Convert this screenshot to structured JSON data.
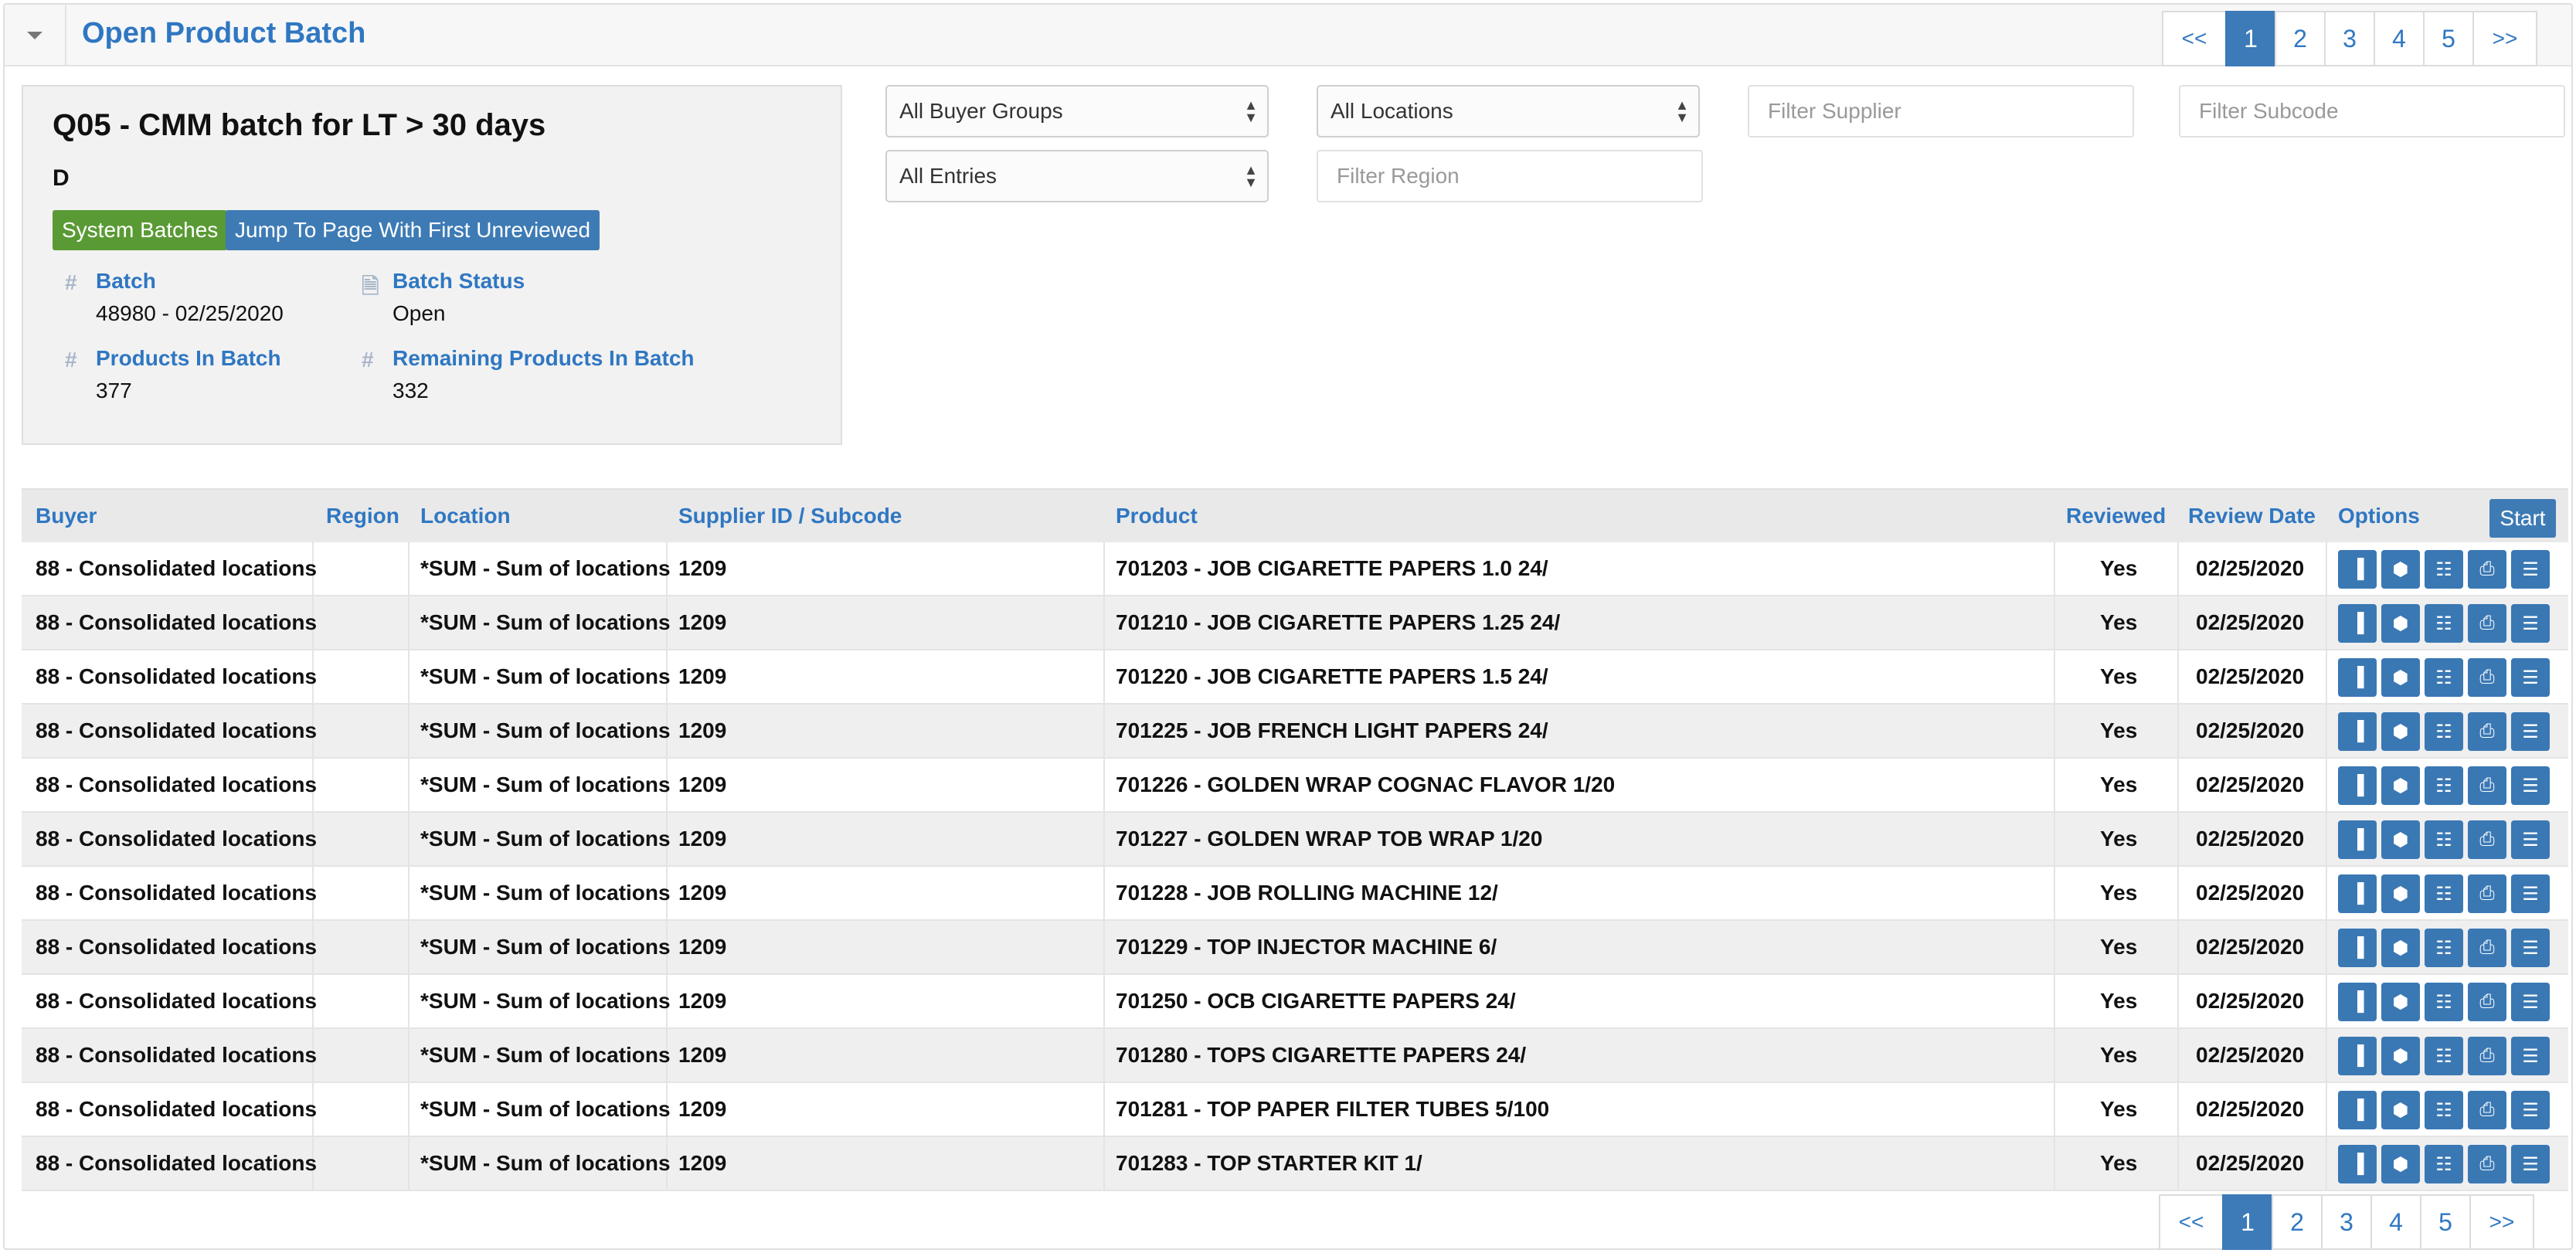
{
  "header": {
    "title": "Open Product Batch"
  },
  "pagination": {
    "prev": "<<",
    "next": ">>",
    "pages": [
      "1",
      "2",
      "3",
      "4",
      "5"
    ],
    "current": "1"
  },
  "batch": {
    "title": "Q05 - CMM batch for LT > 30 days",
    "code": "D",
    "system_batches_label": "System Batches",
    "jump_label": "Jump To Page With First Unreviewed",
    "batch_label": "Batch",
    "batch_value": "48980 - 02/25/2020",
    "status_label": "Batch Status",
    "status_value": "Open",
    "products_label": "Products In Batch",
    "products_value": "377",
    "remaining_label": "Remaining Products In Batch",
    "remaining_value": "332"
  },
  "filters": {
    "buyer_groups": "All Buyer Groups",
    "locations": "All Locations",
    "entries": "All Entries",
    "supplier_placeholder": "Filter Supplier",
    "subcode_placeholder": "Filter Subcode",
    "region_placeholder": "Filter Region"
  },
  "table": {
    "columns": {
      "buyer": "Buyer",
      "region": "Region",
      "location": "Location",
      "supplier": "Supplier ID / Subcode",
      "product": "Product",
      "reviewed": "Reviewed",
      "review_date": "Review Date",
      "options": "Options"
    },
    "start_label": "Start",
    "rows": [
      {
        "buyer": "88 - Consolidated locations",
        "region": "",
        "location": "*SUM - Sum of locations",
        "supplier": "1209",
        "product": "701203 - JOB CIGARETTE PAPERS 1.0 24/",
        "reviewed": "Yes",
        "review_date": "02/25/2020"
      },
      {
        "buyer": "88 - Consolidated locations",
        "region": "",
        "location": "*SUM - Sum of locations",
        "supplier": "1209",
        "product": "701210 - JOB CIGARETTE PAPERS 1.25 24/",
        "reviewed": "Yes",
        "review_date": "02/25/2020"
      },
      {
        "buyer": "88 - Consolidated locations",
        "region": "",
        "location": "*SUM - Sum of locations",
        "supplier": "1209",
        "product": "701220 - JOB CIGARETTE PAPERS 1.5 24/",
        "reviewed": "Yes",
        "review_date": "02/25/2020"
      },
      {
        "buyer": "88 - Consolidated locations",
        "region": "",
        "location": "*SUM - Sum of locations",
        "supplier": "1209",
        "product": "701225 - JOB FRENCH LIGHT PAPERS 24/",
        "reviewed": "Yes",
        "review_date": "02/25/2020"
      },
      {
        "buyer": "88 - Consolidated locations",
        "region": "",
        "location": "*SUM - Sum of locations",
        "supplier": "1209",
        "product": "701226 - GOLDEN WRAP COGNAC FLAVOR 1/20",
        "reviewed": "Yes",
        "review_date": "02/25/2020"
      },
      {
        "buyer": "88 - Consolidated locations",
        "region": "",
        "location": "*SUM - Sum of locations",
        "supplier": "1209",
        "product": "701227 - GOLDEN WRAP TOB WRAP 1/20",
        "reviewed": "Yes",
        "review_date": "02/25/2020"
      },
      {
        "buyer": "88 - Consolidated locations",
        "region": "",
        "location": "*SUM - Sum of locations",
        "supplier": "1209",
        "product": "701228 - JOB ROLLING MACHINE 12/",
        "reviewed": "Yes",
        "review_date": "02/25/2020"
      },
      {
        "buyer": "88 - Consolidated locations",
        "region": "",
        "location": "*SUM - Sum of locations",
        "supplier": "1209",
        "product": "701229 - TOP INJECTOR MACHINE 6/",
        "reviewed": "Yes",
        "review_date": "02/25/2020"
      },
      {
        "buyer": "88 - Consolidated locations",
        "region": "",
        "location": "*SUM - Sum of locations",
        "supplier": "1209",
        "product": "701250 - OCB CIGARETTE PAPERS 24/",
        "reviewed": "Yes",
        "review_date": "02/25/2020"
      },
      {
        "buyer": "88 - Consolidated locations",
        "region": "",
        "location": "*SUM - Sum of locations",
        "supplier": "1209",
        "product": "701280 - TOPS CIGARETTE PAPERS 24/",
        "reviewed": "Yes",
        "review_date": "02/25/2020"
      },
      {
        "buyer": "88 - Consolidated locations",
        "region": "",
        "location": "*SUM - Sum of locations",
        "supplier": "1209",
        "product": "701281 - TOP PAPER FILTER TUBES 5/100",
        "reviewed": "Yes",
        "review_date": "02/25/2020"
      },
      {
        "buyer": "88 - Consolidated locations",
        "region": "",
        "location": "*SUM - Sum of locations",
        "supplier": "1209",
        "product": "701283 - TOP STARTER KIT 1/",
        "reviewed": "Yes",
        "review_date": "02/25/2020"
      }
    ],
    "row_option_icons": [
      "barcode-icon",
      "cube-icon",
      "sitemap-icon",
      "document-icon",
      "list-icon"
    ]
  },
  "colors": {
    "accent": "#2f77c2",
    "button_blue": "#3e7bb5",
    "button_green": "#5a9a35"
  }
}
